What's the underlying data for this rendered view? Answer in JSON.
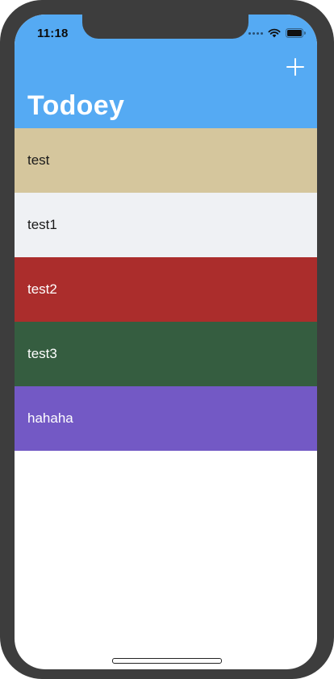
{
  "status_bar": {
    "time": "11:18",
    "signal_icon": "signal-dots-icon",
    "wifi_icon": "wifi-icon",
    "battery_icon": "battery-icon"
  },
  "nav": {
    "title": "Todoey",
    "add_icon": "plus-icon",
    "background": "#55aaf3",
    "tint": "#ffffff"
  },
  "items": [
    {
      "label": "test",
      "bg": "#d5c69d",
      "fg": "#1a1a1a"
    },
    {
      "label": "test1",
      "bg": "#eff1f4",
      "fg": "#1a1a1a"
    },
    {
      "label": "test2",
      "bg": "#ab2d2c",
      "fg": "#ffffff"
    },
    {
      "label": "test3",
      "bg": "#355d40",
      "fg": "#ffffff"
    },
    {
      "label": "hahaha",
      "bg": "#7359c5",
      "fg": "#ffffff"
    }
  ]
}
